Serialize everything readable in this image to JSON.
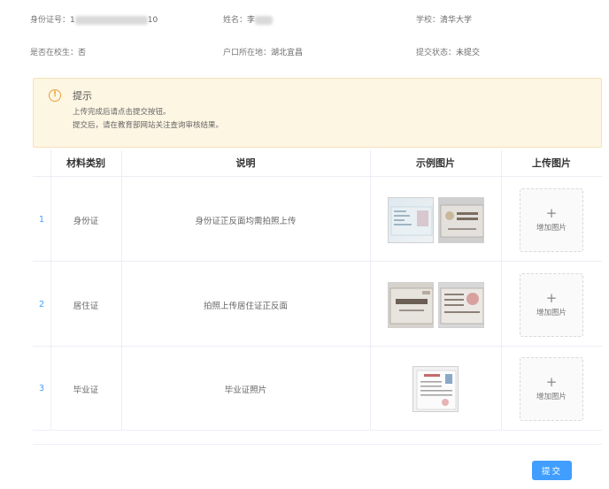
{
  "info": {
    "id_label": "身份证号：",
    "id_prefix": "1",
    "id_suffix": "10",
    "name_label": "姓名：",
    "name_value": "李",
    "school_label": "学校：",
    "school_value": "清华大学",
    "enrolled_label": "是否在校生：",
    "enrolled_value": "否",
    "hukou_label": "户口所在地：",
    "hukou_value": "湖北宜昌",
    "status_label": "提交状态：",
    "status_value": "未提交"
  },
  "tip": {
    "icon": "info-circle-icon",
    "title": "提示",
    "line1": "上传完成后请点击提交按钮。",
    "line2": "提交后，请在教育部网站关注查询审核结果。",
    "color": "#e6a23c"
  },
  "table": {
    "headers": [
      "材料类别",
      "说明",
      "示例图片",
      "上传图片"
    ],
    "rows": [
      {
        "index": "1",
        "category": "身份证",
        "description": "身份证正反面均需拍照上传",
        "upload_label": "增加图片"
      },
      {
        "index": "2",
        "category": "居住证",
        "description": "拍照上传居住证正反面",
        "upload_label": "增加图片"
      },
      {
        "index": "3",
        "category": "毕业证",
        "description": "毕业证照片",
        "upload_label": "增加图片"
      }
    ]
  },
  "upload_plus": "+",
  "submit_label": "提交",
  "accent": "#409eff"
}
